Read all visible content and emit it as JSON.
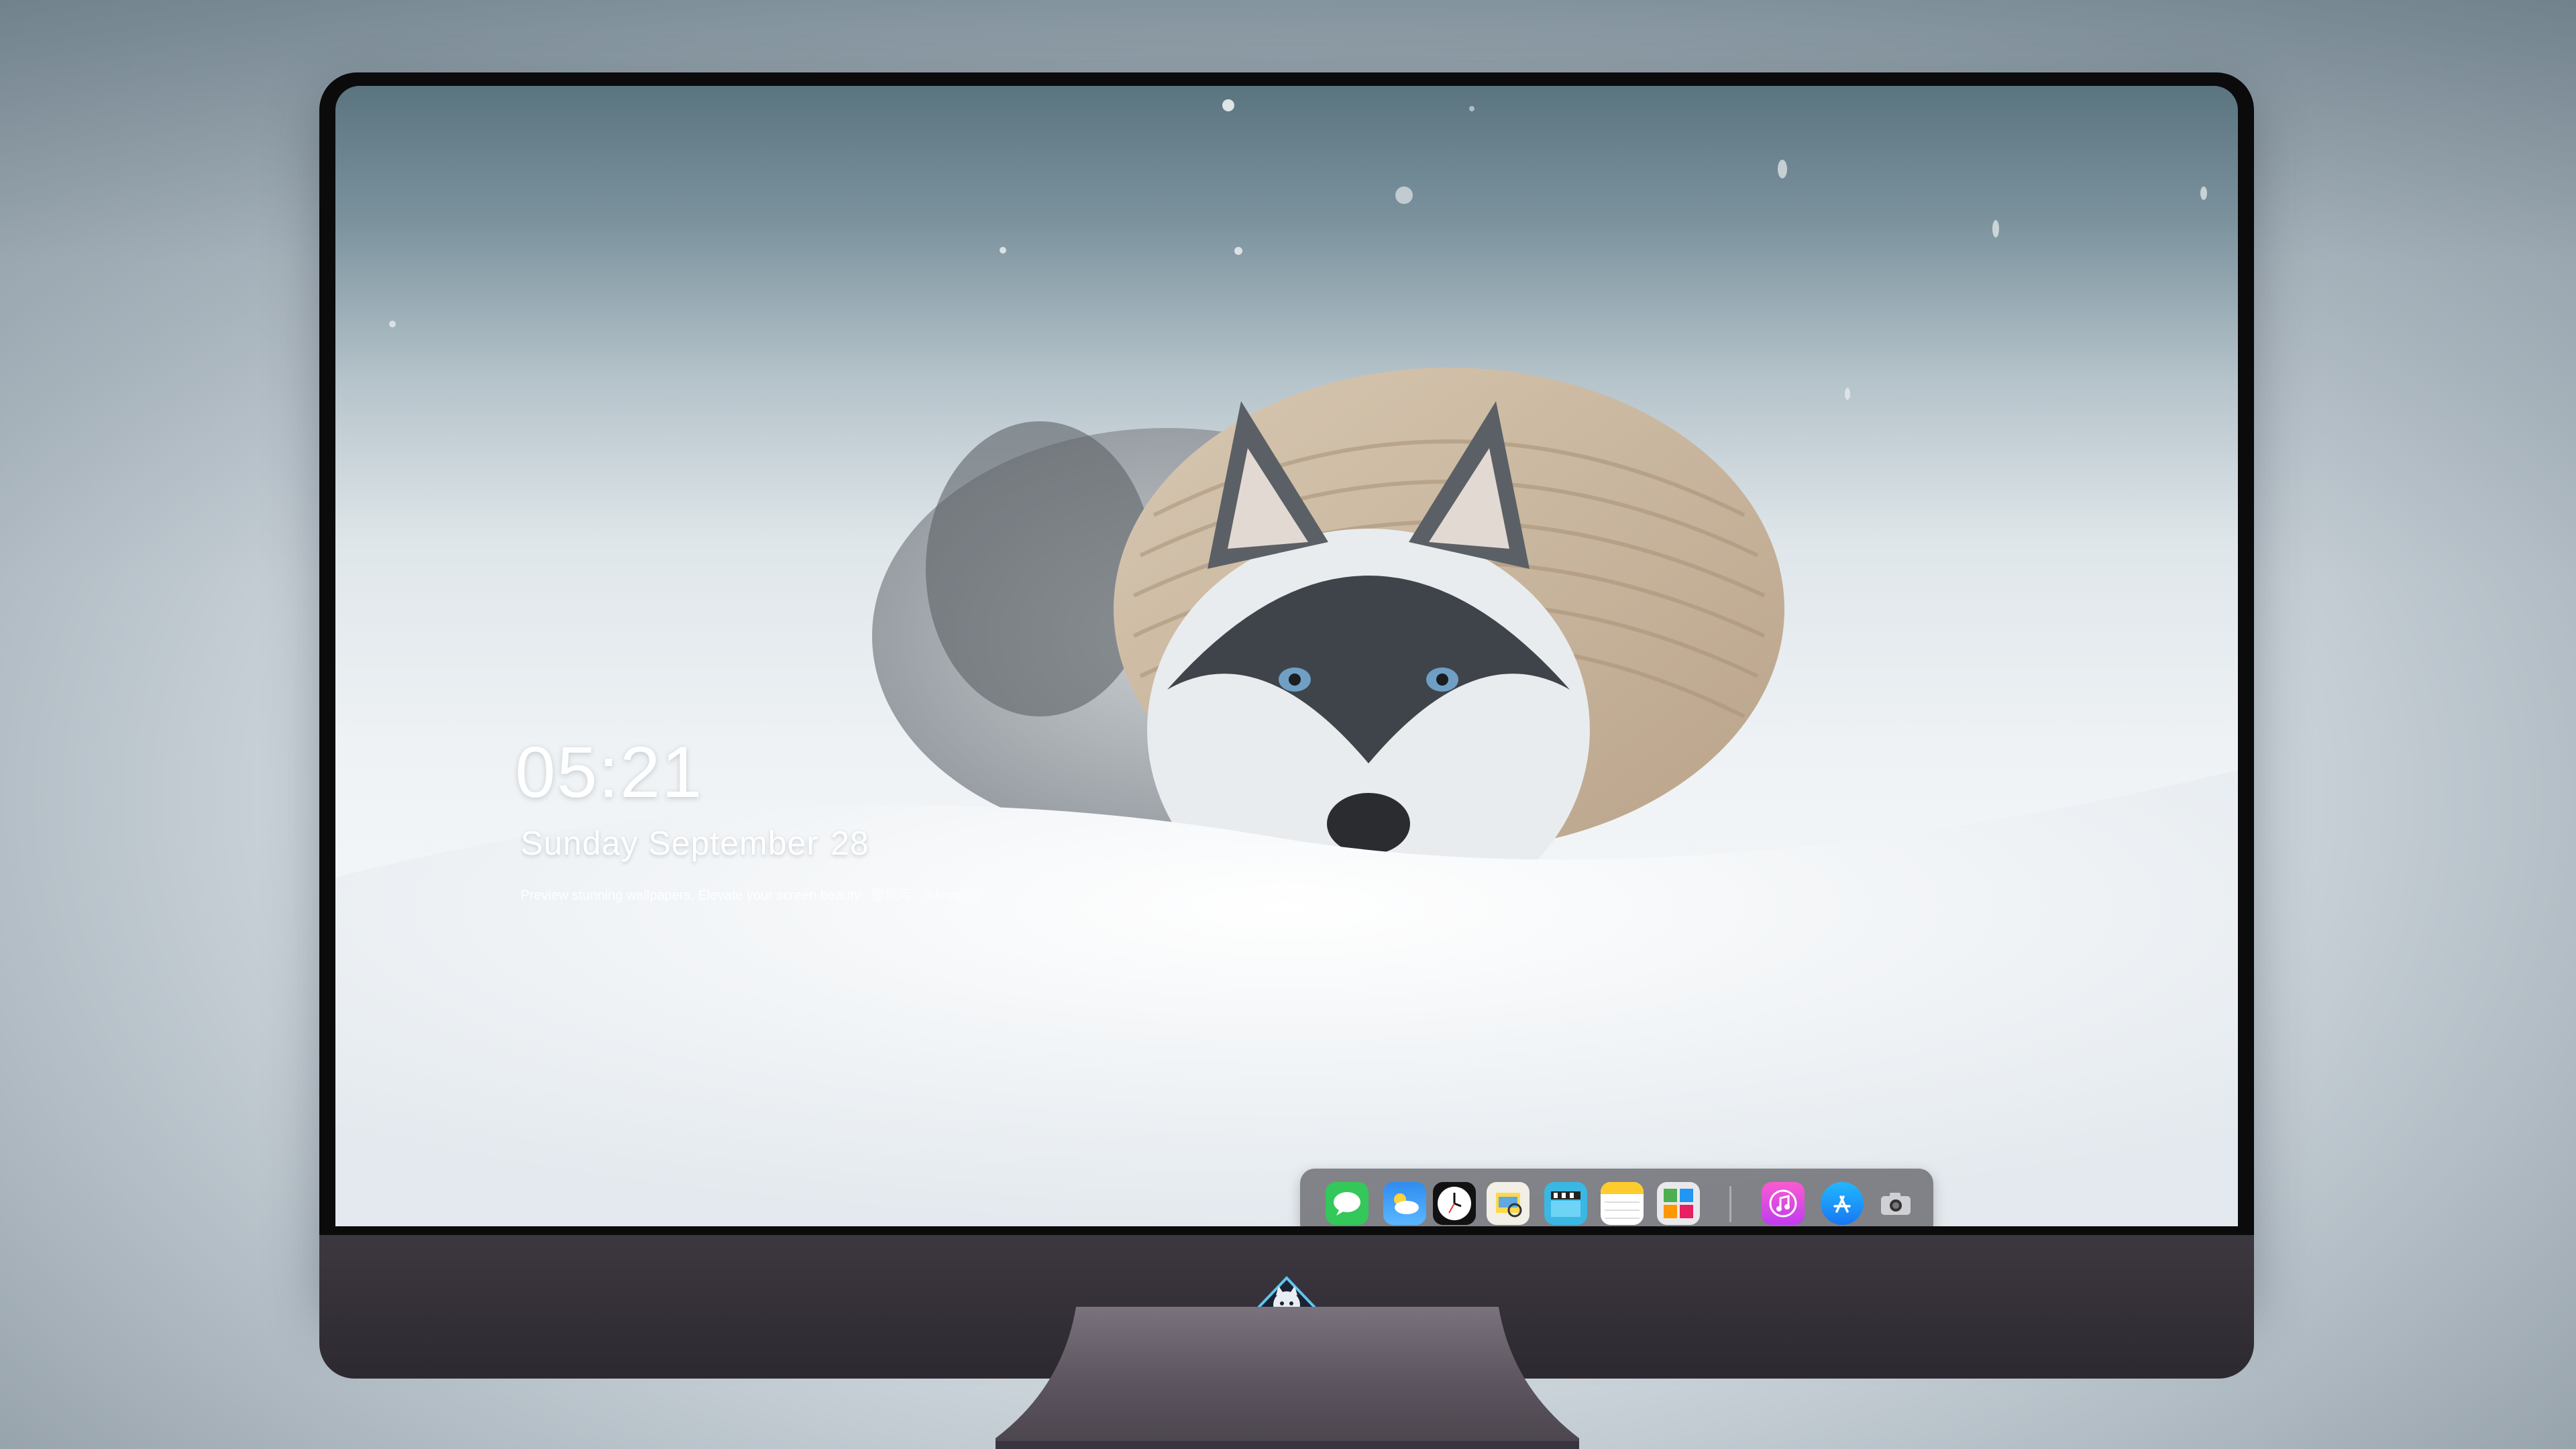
{
  "lock_screen": {
    "time": "05:21",
    "weekday_month": "Sunday September",
    "day": "28",
    "caption": "Preview stunning wallpapers. Elevate your screen beauty.",
    "caption_tag": "壁纸库 · 3dmmCN"
  },
  "dock": {
    "apps": [
      {
        "name": "messages-icon"
      },
      {
        "name": "weather-icon"
      },
      {
        "name": "clock-icon"
      },
      {
        "name": "preview-icon"
      },
      {
        "name": "video-editor-icon"
      },
      {
        "name": "notes-icon"
      },
      {
        "name": "photo-booth-icon"
      },
      {
        "name": "music-icon"
      },
      {
        "name": "app-store-icon"
      },
      {
        "name": "camera-icon"
      }
    ]
  },
  "colors": {
    "dock_background": "#5a5a60",
    "monitor_chin": "#2d2930",
    "monitor_bezel": "#0b0b0c"
  }
}
